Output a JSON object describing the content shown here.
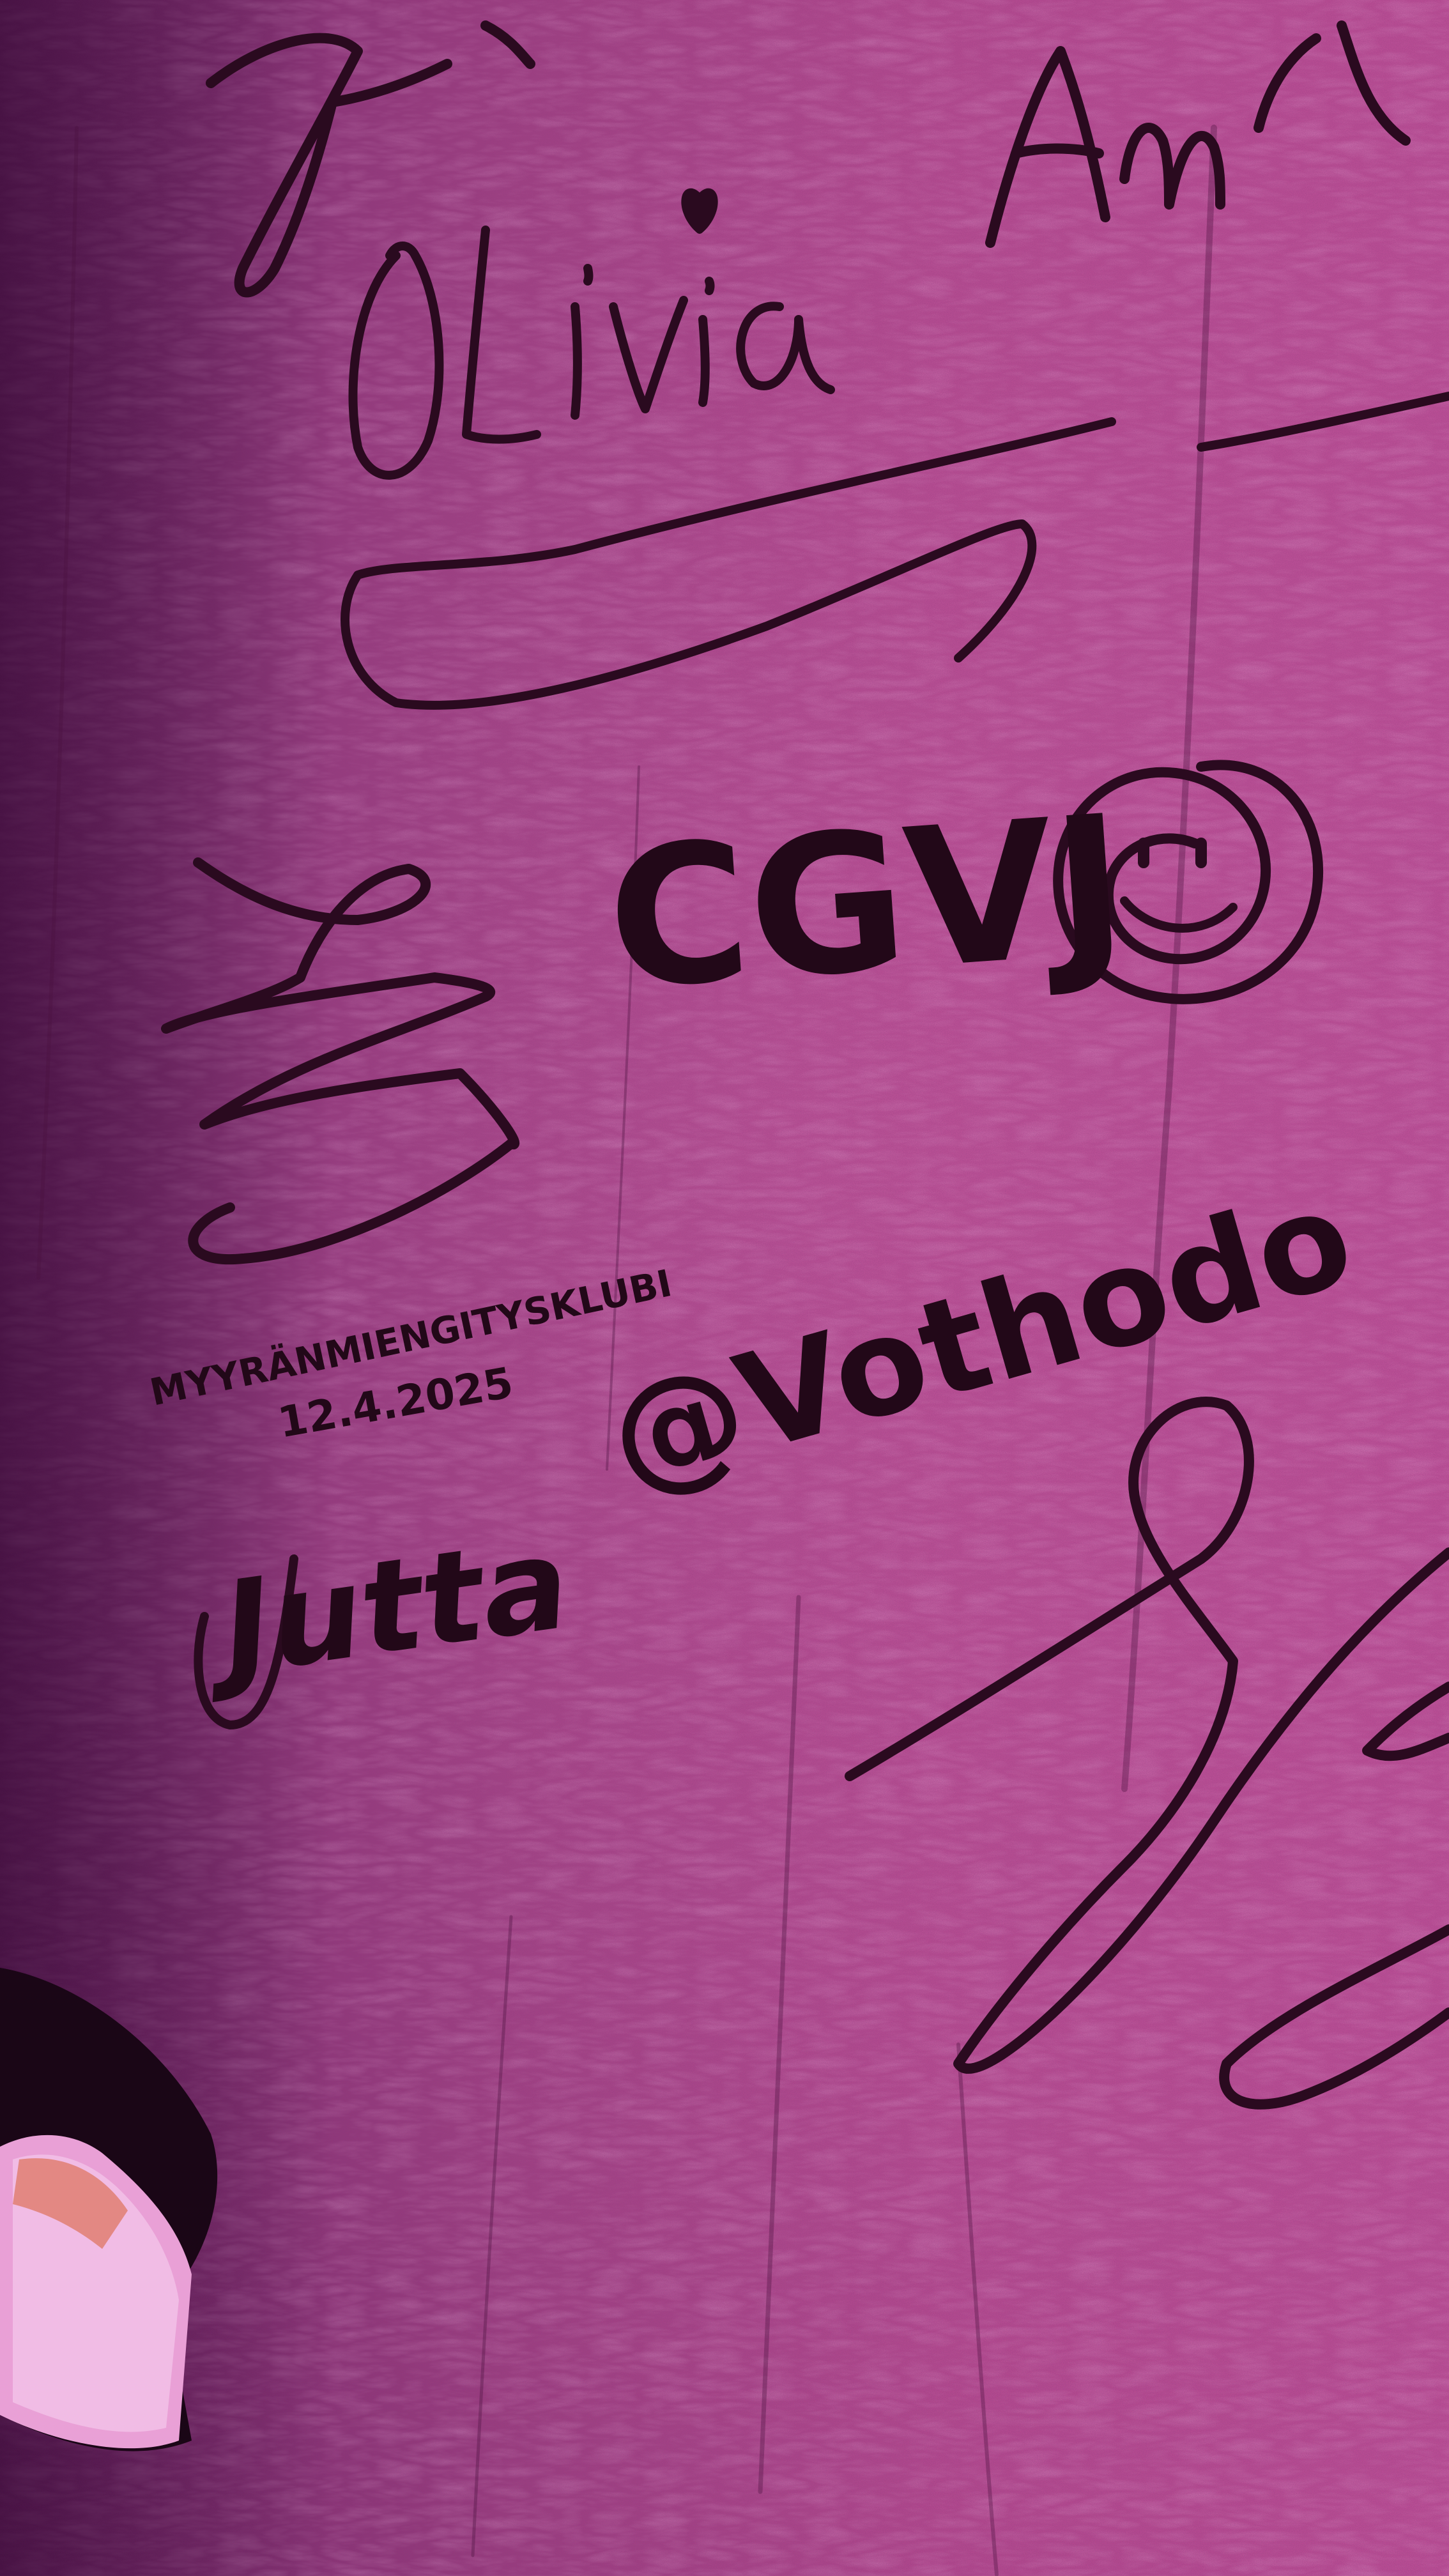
{
  "photo": {
    "subject": "signature wall",
    "colors": {
      "wall_base": "#8a2f72",
      "wall_light": "#c0529e",
      "wall_shadow": "#4a1240",
      "ink": "#2a0a1f",
      "hole_dark": "#1a0616",
      "hole_light": "#f2c3e8"
    }
  },
  "inscriptions": {
    "olivia": "OLivia",
    "cgvj": "CGVJ",
    "handle": "@Vothodo",
    "club": "MYYRÄNMIENGITYSKLUBI",
    "date": "12.4.2025",
    "jutta": "Jutta",
    "amp": "Amp"
  }
}
